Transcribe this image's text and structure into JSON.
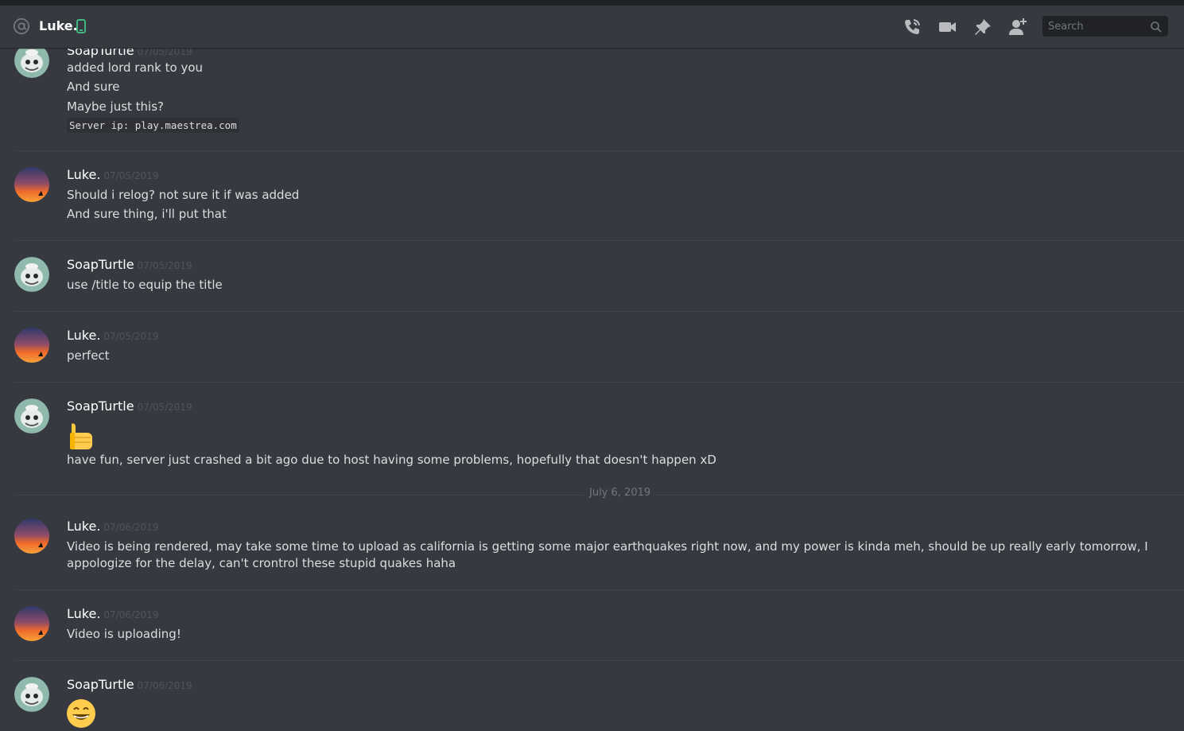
{
  "header": {
    "channel_name": "Luke.",
    "search_placeholder": "Search"
  },
  "messages": [
    {
      "author": "SoapTurtle",
      "timestamp": "07/05/2019",
      "lines": [
        "added lord rank to you",
        "And sure",
        "Maybe just this?"
      ],
      "code": "Server ip: play.maestrea.com"
    },
    {
      "author": "Luke.",
      "timestamp": "07/05/2019",
      "lines": [
        "Should i relog? not sure it if was added",
        "And sure thing, i'll put that"
      ]
    },
    {
      "author": "SoapTurtle",
      "timestamp": "07/05/2019",
      "lines": [
        "use /title to equip the title"
      ]
    },
    {
      "author": "Luke.",
      "timestamp": "07/05/2019",
      "lines": [
        "perfect"
      ]
    },
    {
      "author": "SoapTurtle",
      "timestamp": "07/05/2019",
      "emoji": "thumbs-up",
      "lines": [
        "have fun, server just crashed a bit ago due to host having some problems, hopefully that doesn't happen xD"
      ]
    },
    {
      "author": "Luke.",
      "timestamp": "07/06/2019",
      "lines": [
        "Video is being rendered, may take some time to upload as california is getting some major earthquakes right now, and my power is kinda meh, should be up really early tomorrow, I appologize for the delay, can't crontrol these stupid quakes haha"
      ]
    },
    {
      "author": "Luke.",
      "timestamp": "07/06/2019",
      "lines": [
        "Video is uploading!"
      ]
    },
    {
      "author": "SoapTurtle",
      "timestamp": "07/06/2019",
      "emoji": "grinning-face"
    }
  ],
  "date_separator": "July 6, 2019",
  "colors": {
    "background": "#36393f",
    "online_mobile": "#43b581",
    "timestamp": "#4f545c"
  }
}
